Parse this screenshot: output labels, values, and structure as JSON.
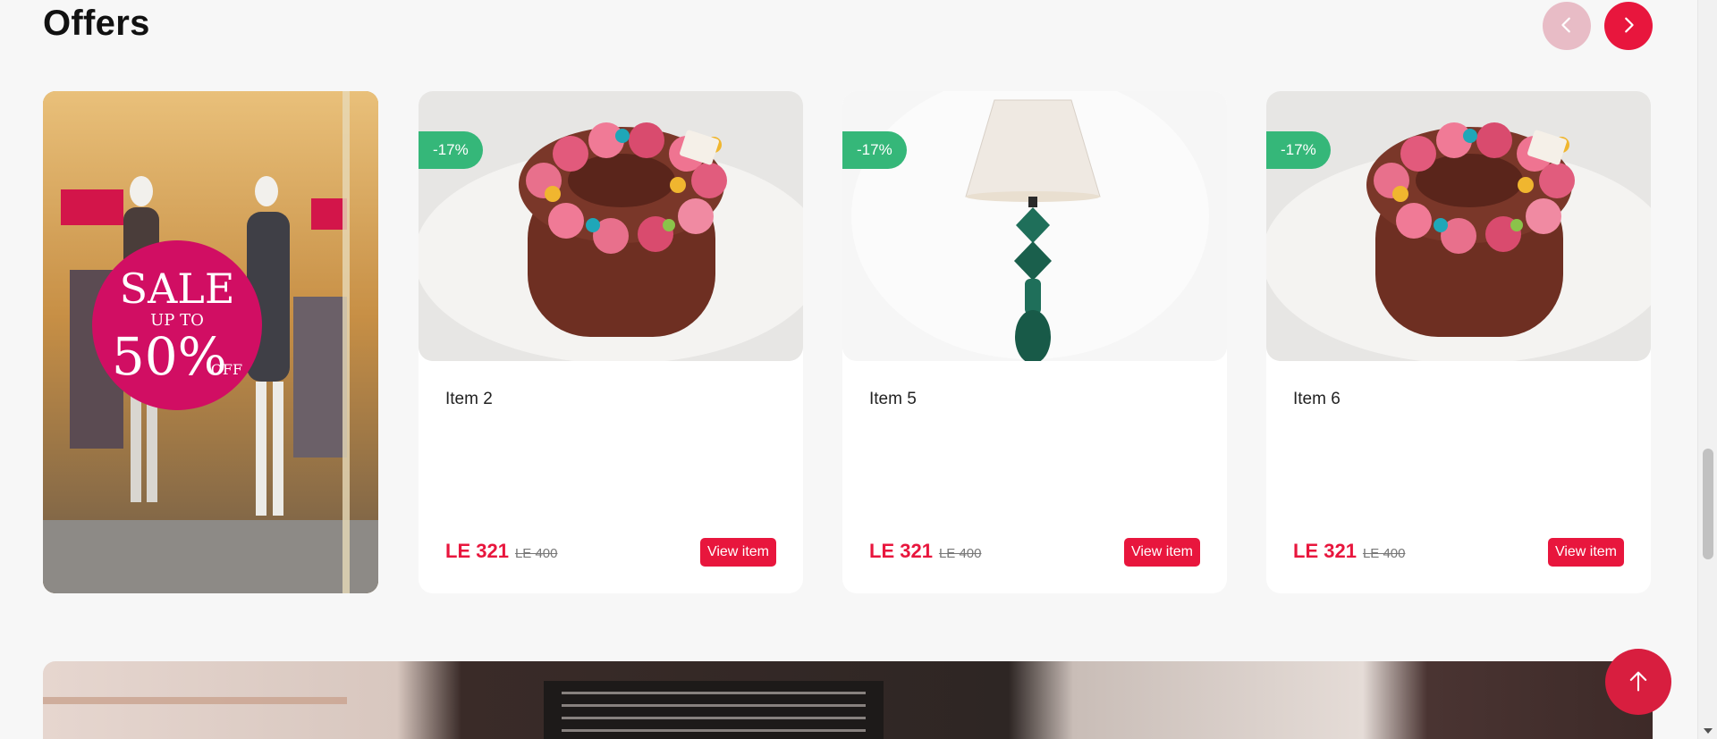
{
  "section": {
    "title": "Offers"
  },
  "carousel": {
    "prev_icon": "chevron-left-icon",
    "next_icon": "chevron-right-icon"
  },
  "promo": {
    "sign_line1": "SALE",
    "sign_line2": "UP TO",
    "sign_percent": "50%",
    "sign_off": "OFF",
    "sign_color": "#d10e63"
  },
  "products": [
    {
      "name": "Item 2",
      "discount": "-17%",
      "price": "LE 321",
      "old_price": "LE 400",
      "button": "View item",
      "image": "cake"
    },
    {
      "name": "Item 5",
      "discount": "-17%",
      "price": "LE 321",
      "old_price": "LE 400",
      "button": "View item",
      "image": "lamp"
    },
    {
      "name": "Item 6",
      "discount": "-17%",
      "price": "LE 321",
      "old_price": "LE 400",
      "button": "View item",
      "image": "cake"
    }
  ],
  "scroll_top": {
    "icon": "arrow-up-icon"
  },
  "colors": {
    "accent": "#e8163d",
    "badge": "#35b779",
    "prev_disabled": "#e8bcc6"
  }
}
